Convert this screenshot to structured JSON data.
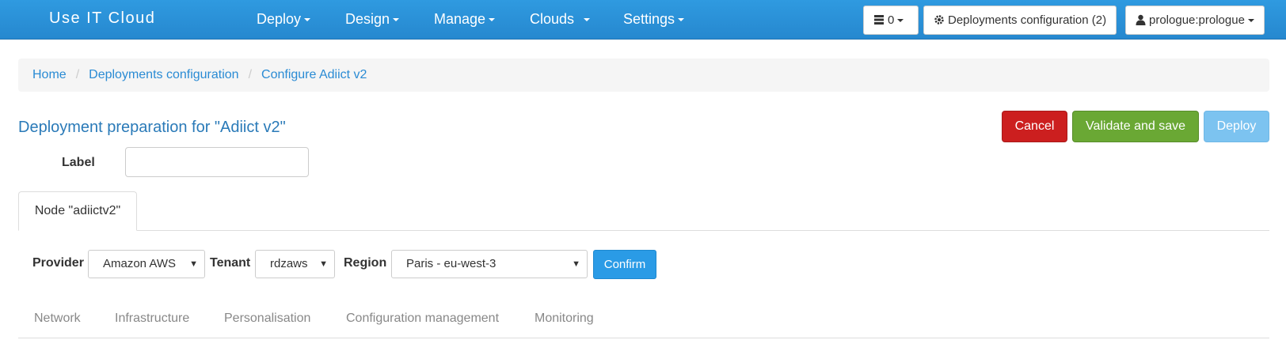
{
  "navbar": {
    "brand": "Use IT Cloud",
    "menus": [
      {
        "label": "Deploy"
      },
      {
        "label": "Design"
      },
      {
        "label": "Manage"
      },
      {
        "label": "Clouds"
      },
      {
        "label": "Settings"
      }
    ],
    "server_count": "0",
    "deployments_config": "Deployments configuration (2)",
    "user": "prologue:prologue"
  },
  "breadcrumb": {
    "items": [
      "Home",
      "Deployments configuration",
      "Configure Adiict v2"
    ],
    "separator": "/"
  },
  "page": {
    "title": "Deployment preparation for \"Adiict v2\"",
    "label_caption": "Label",
    "label_value": ""
  },
  "actions": {
    "cancel": "Cancel",
    "validate": "Validate and save",
    "deploy": "Deploy"
  },
  "node_tab": "Node \"adiictv2\"",
  "provider_row": {
    "provider_label": "Provider",
    "provider_value": "Amazon AWS",
    "tenant_label": "Tenant",
    "tenant_value": "rdzaws",
    "region_label": "Region",
    "region_value": "Paris - eu-west-3",
    "confirm": "Confirm"
  },
  "sections": [
    "Network",
    "Infrastructure",
    "Personalisation",
    "Configuration management",
    "Monitoring"
  ],
  "colors": {
    "navbar": "#2688cf",
    "cancel": "#cc1f1f",
    "validate": "#6aa834",
    "deploy": "#7cc3f0",
    "confirm": "#2a9be6",
    "link": "#2a8bd4"
  }
}
